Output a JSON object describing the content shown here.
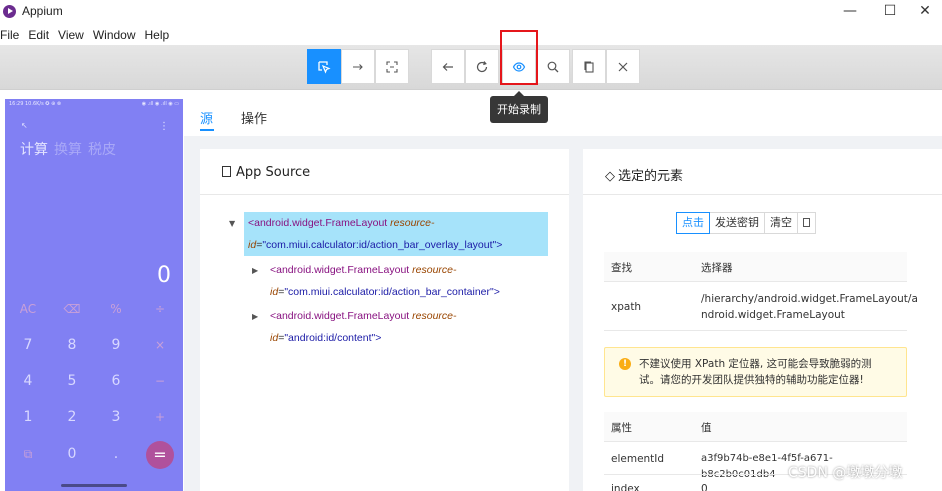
{
  "window": {
    "title": "Appium",
    "controls": {
      "minimize": "—",
      "maximize": "☐",
      "close": "✕"
    }
  },
  "menu": [
    "File",
    "Edit",
    "View",
    "Window",
    "Help"
  ],
  "toolbar": {
    "buttons": [
      {
        "icon": "select-icon",
        "active": true
      },
      {
        "icon": "swipe-icon"
      },
      {
        "icon": "tap-coordinates-icon"
      },
      {
        "icon": "back-icon"
      },
      {
        "icon": "refresh-icon"
      },
      {
        "icon": "record-eye-icon"
      },
      {
        "icon": "search-icon"
      },
      {
        "icon": "copy-icon"
      },
      {
        "icon": "close-icon"
      }
    ],
    "tooltip": "开始录制",
    "accent": "#1890ff",
    "highlight_color": "#e5161b"
  },
  "phone": {
    "status_left": "16:29 10.6K/s ✪ ⊕ ⊗",
    "status_right": "◉ .ıll ◉ .ıll ◉ ▭",
    "tabs": [
      "计算",
      "换算",
      "税皮"
    ],
    "display": "0",
    "keys": [
      [
        "AC",
        "⌫",
        "%",
        "÷"
      ],
      [
        "7",
        "8",
        "9",
        "×"
      ],
      [
        "4",
        "5",
        "6",
        "−"
      ],
      [
        "1",
        "2",
        "3",
        "+"
      ],
      [
        "⧉",
        "0",
        ".",
        "="
      ]
    ],
    "screen_color": "#8180f3",
    "equals_color": "#b0519c"
  },
  "main_tabs": [
    "源",
    "操作"
  ],
  "source": {
    "title": "App Source",
    "nodes": [
      {
        "tag": "<android.widget.FrameLayout",
        "attr": "resource-id",
        "value": "\"com.miui.calculator:id/action_bar_overlay_layout\">",
        "selected": true
      },
      {
        "tag": "<android.widget.FrameLayout",
        "attr": "resource-id",
        "value": "\"com.miui.calculator:id/action_bar_container\">",
        "selected": false
      },
      {
        "tag": "<android.widget.FrameLayout",
        "attr": "resource-id",
        "value": "\"android:id/content\">",
        "selected": false
      }
    ],
    "selected_color": "#a6e3fa"
  },
  "element": {
    "title": "选定的元素",
    "actions": [
      "点击",
      "发送密钥",
      "清空"
    ],
    "find_header": {
      "col1": "查找",
      "col2": "选择器"
    },
    "find_rows": [
      {
        "key": "xpath",
        "line1": "/hierarchy/android.widget.FrameLayout/a",
        "line2": "ndroid.widget.FrameLayout"
      }
    ],
    "warning_line1": "不建议使用 XPath 定位器, 这可能会导致脆弱的测",
    "warning_line2": "试。请您的开发团队提供独特的辅助功能定位器!",
    "attr_header": {
      "col1": "属性",
      "col2": "值"
    },
    "attr_rows": [
      {
        "key": "elementId",
        "value": "a3f9b74b-e8e1-4f5f-a671-b8c2b0c01db4"
      },
      {
        "key": "index",
        "value": "0"
      }
    ]
  },
  "watermark": "CSDN @墩墩分墩"
}
